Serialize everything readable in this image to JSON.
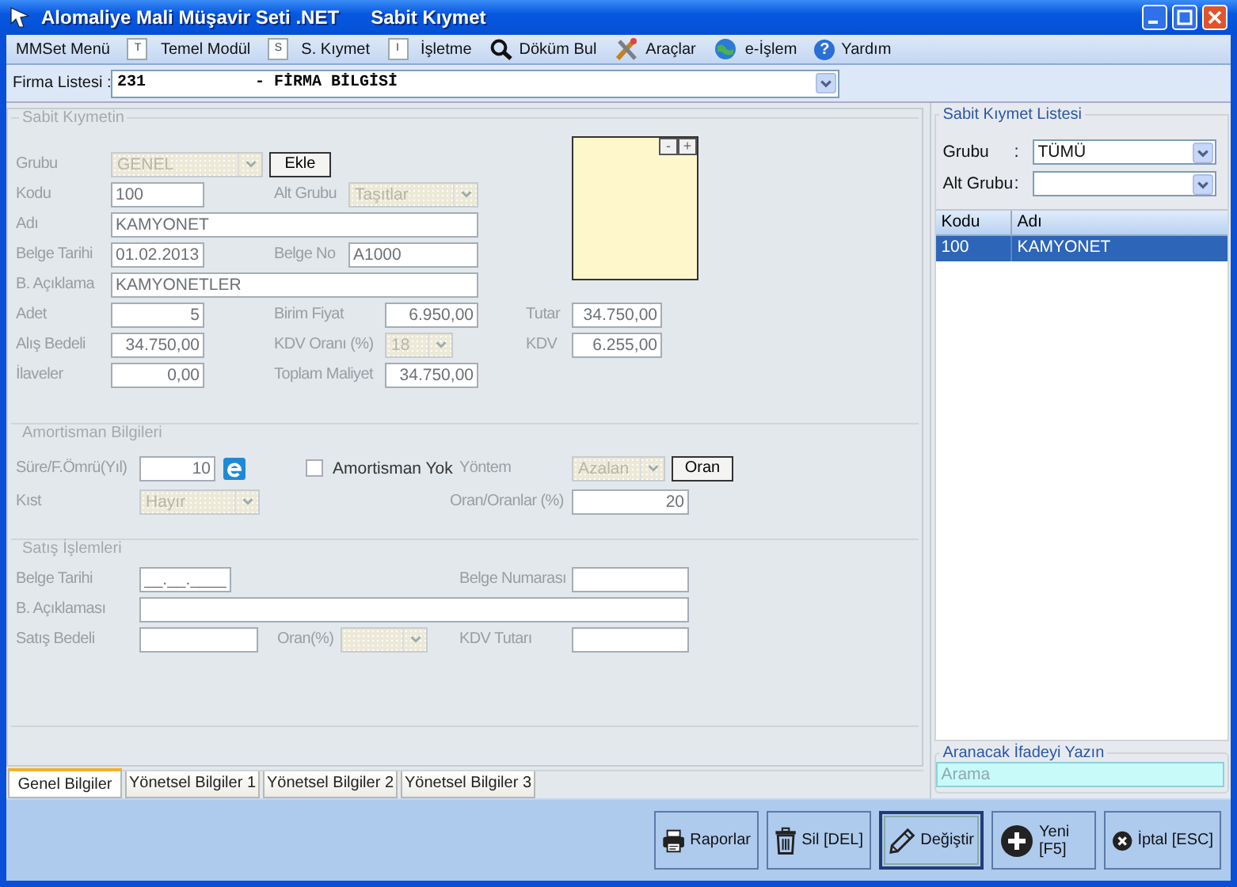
{
  "window": {
    "title": "Alomaliye Mali Müşavir Seti .NET",
    "module": "Sabit Kıymet"
  },
  "menu": [
    {
      "label": "MMSet Menü",
      "kind": "plain"
    },
    {
      "label": "Temel Modül",
      "kind": "page",
      "letter": "T"
    },
    {
      "label": "S. Kıymet",
      "kind": "page",
      "letter": "S"
    },
    {
      "label": "İşletme",
      "kind": "page",
      "letter": "I"
    },
    {
      "label": "Döküm Bul",
      "kind": "search"
    },
    {
      "label": "Araçlar",
      "kind": "tools"
    },
    {
      "label": "e-İşlem",
      "kind": "globe"
    },
    {
      "label": "Yardım",
      "kind": "help",
      "letter": "?"
    }
  ],
  "firma": {
    "label": "Firma Listesi :",
    "code": "231",
    "name": "- FİRMA BİLGİSİ"
  },
  "asset": {
    "title": "Sabit Kıymetin",
    "add_button": "Ekle",
    "image": {
      "minus": "-",
      "plus": "+"
    },
    "fields": [
      {
        "label": "Grubu",
        "value": "GENEL",
        "kind": "combo",
        "disabled": true
      },
      {
        "label": "Kodu",
        "value": "100",
        "kind": "text"
      },
      {
        "label": "Alt Grubu",
        "value": "Taşıtlar",
        "kind": "combo",
        "disabled": true
      },
      {
        "label": "Adı",
        "value": "KAMYONET",
        "kind": "text"
      },
      {
        "label": "Belge Tarihi",
        "value": "01.02.2013",
        "kind": "text"
      },
      {
        "label": "Belge No",
        "value": "A1000",
        "kind": "text"
      },
      {
        "label": "B. Açıklama",
        "value": "KAMYONETLER",
        "kind": "text"
      },
      {
        "label": "Adet",
        "value": "5",
        "kind": "number"
      },
      {
        "label": "Birim Fiyat",
        "value": "6.950,00",
        "kind": "number"
      },
      {
        "label": "Tutar",
        "value": "34.750,00",
        "kind": "number"
      },
      {
        "label": "Alış Bedeli",
        "value": "34.750,00",
        "kind": "number"
      },
      {
        "label": "KDV Oranı (%)",
        "value": "18",
        "kind": "combo",
        "disabled": true
      },
      {
        "label": "KDV",
        "value": "6.255,00",
        "kind": "number"
      },
      {
        "label": "İlaveler",
        "value": "0,00",
        "kind": "number"
      },
      {
        "label": "Toplam Maliyet",
        "value": "34.750,00",
        "kind": "number"
      }
    ]
  },
  "depreciation": {
    "title": "Amortisman Bilgileri",
    "no_depreciation": {
      "label": "Amortisman Yok",
      "checked": false
    },
    "rate_button": "Oran",
    "fields": [
      {
        "label": "Süre/F.Ömrü(Yıl)",
        "value": "10",
        "kind": "number"
      },
      {
        "label": "Kıst",
        "value": "Hayır",
        "kind": "combo",
        "disabled": true
      },
      {
        "label": "Yöntem",
        "value": "Azalan",
        "kind": "combo",
        "disabled": true
      },
      {
        "label": "Oran/Oranlar (%)",
        "value": "20",
        "kind": "number"
      }
    ]
  },
  "sales": {
    "title": "Satış İşlemleri",
    "fields": [
      {
        "label": "Belge Tarihi",
        "value": "__.__.____",
        "kind": "text"
      },
      {
        "label": "Belge Numarası",
        "kind": "text"
      },
      {
        "label": "B. Açıklaması",
        "kind": "text"
      },
      {
        "label": "Satış Bedeli",
        "kind": "text"
      },
      {
        "label": "Oran(%)",
        "kind": "combo",
        "disabled": true
      },
      {
        "label": "KDV Tutarı",
        "kind": "text"
      }
    ]
  },
  "tabs": [
    {
      "label": "Genel Bilgiler",
      "selected": true
    },
    {
      "label": "Yönetsel Bilgiler 1",
      "selected": false
    },
    {
      "label": "Yönetsel Bilgiler 2",
      "selected": false
    },
    {
      "label": "Yönetsel Bilgiler 3",
      "selected": false
    }
  ],
  "list_panel": {
    "title": "Sabit Kıymet Listesi",
    "filters": [
      {
        "label": "Grubu",
        "separator": ":",
        "value": "TÜMÜ",
        "kind": "combo",
        "disabled": false
      },
      {
        "label": "Alt Grubu",
        "separator": ":",
        "kind": "combo",
        "disabled": false
      }
    ],
    "table": {
      "columns": [
        "Kodu",
        "Adı"
      ],
      "rows": [
        {
          "cells": [
            "100",
            "KAMYONET"
          ],
          "selected": true
        }
      ]
    },
    "search": {
      "title": "Aranacak İfadeyi Yazın",
      "placeholder": "Arama"
    }
  },
  "buttons": [
    {
      "label": "Raporlar",
      "kind": "print",
      "focused": false
    },
    {
      "label": "Sil [DEL]",
      "kind": "delete",
      "focused": false
    },
    {
      "label": "Değiştir",
      "kind": "edit",
      "focused": true
    },
    {
      "label": "Yeni\n[F5]",
      "kind": "new",
      "focused": false
    },
    {
      "label": "İptal [ESC]",
      "kind": "cancel",
      "focused": false
    }
  ]
}
